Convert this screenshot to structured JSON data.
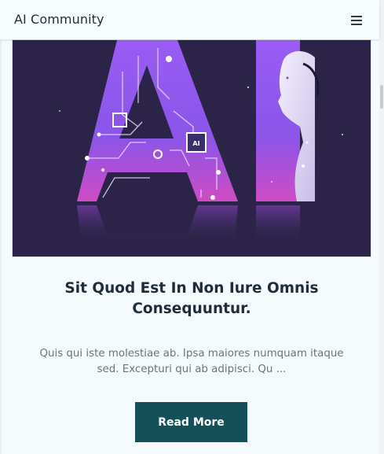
{
  "navbar": {
    "brand": "AI Community",
    "menu_icon": "hamburger-menu-icon"
  },
  "hero": {
    "image_text": "AI",
    "chip_label": "AI"
  },
  "post": {
    "title": "Sit Quod Est In Non Iure Omnis Consequuntur.",
    "excerpt": "Quis qui iste molestiae ab. Ipsa maiores numquam itaque sed. Excepturi qui ab adipisci. Qu ...",
    "read_more_label": "Read More"
  },
  "colors": {
    "button": "#154f57",
    "hero_background": "#2b2448",
    "hero_gradient_top": "#8f5bf0",
    "hero_gradient_bottom": "#d14fc0"
  }
}
